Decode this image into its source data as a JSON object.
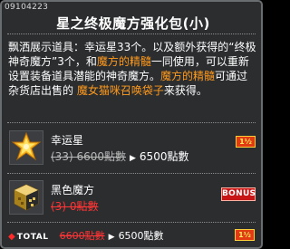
{
  "header": {
    "item_id": "09104223",
    "title": "星之终极魔方强化包(小)"
  },
  "description": {
    "part1": "飘洒展示道具：幸运星33个。以及额外获得的“终极神奇魔方”3个，和",
    "highlight1": "魔方的精髓",
    "part2": "一同使用，可以重新设置装备道具潜能的神奇魔方。",
    "highlight2": "魔方的精髓",
    "part3": "可通过杂货店出售的",
    "highlight3": "魔女猫咪召唤袋子",
    "part4": "来获得。"
  },
  "items": [
    {
      "name": "幸运星",
      "old_price": "(33) 6600點數",
      "arrow": "▶",
      "new_price": "6500點數",
      "badge": "1½",
      "icon": "lucky-star-icon"
    },
    {
      "name": "黑色魔方",
      "old_price": "(3) 0點數",
      "badge": "BONUS",
      "icon": "black-cube-icon"
    }
  ],
  "total": {
    "bullet": "◆",
    "label": "TOTAL",
    "old_price": "6600點數",
    "arrow": "▶",
    "new_price": "6500點數",
    "badge": "1½"
  },
  "colors": {
    "highlight": "#ff9a1e",
    "strike_red": "#ff3434",
    "badge_red": "#e23a12",
    "bonus_red": "#c81616"
  }
}
